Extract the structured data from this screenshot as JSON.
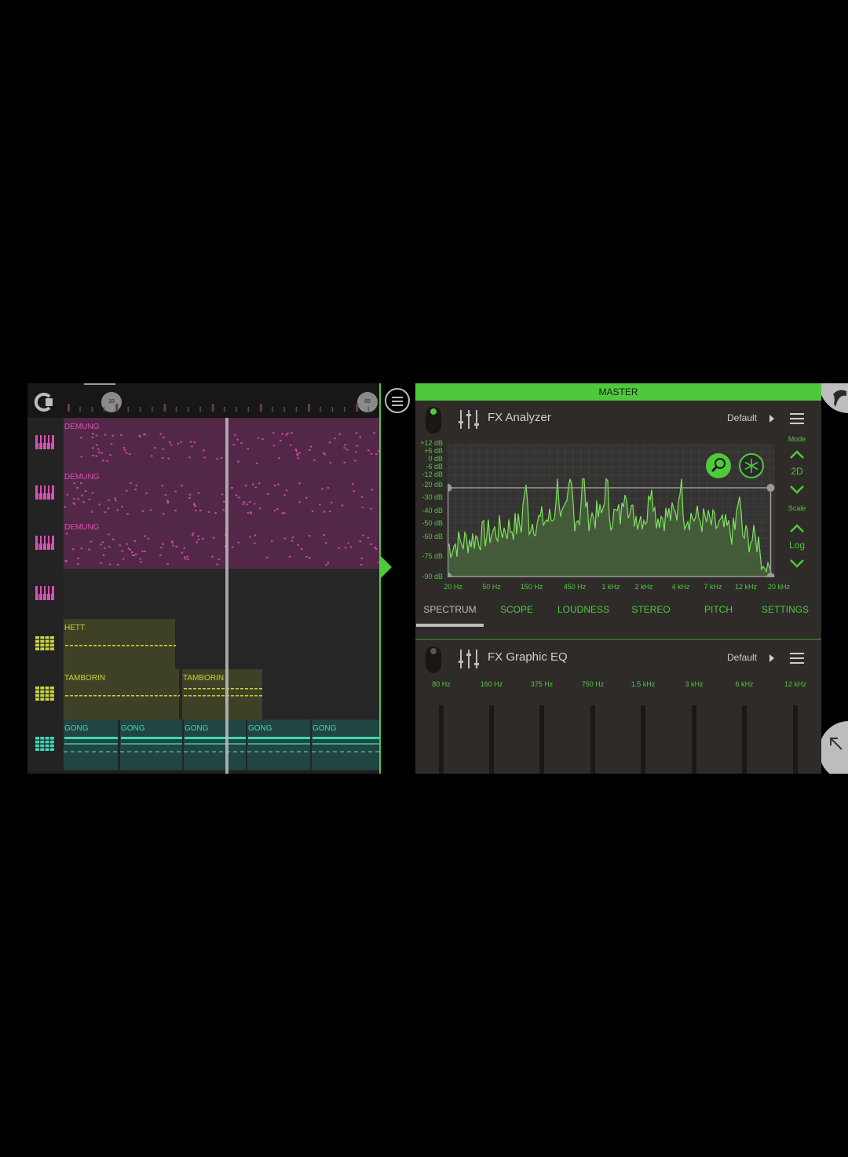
{
  "arranger": {
    "markers": [
      "33",
      "65"
    ],
    "tracks": [
      {
        "icon": "piano-icon",
        "color": "#d94fb5",
        "clips": [
          {
            "label": "DEMUNG",
            "type": "melody"
          }
        ]
      },
      {
        "icon": "piano-icon",
        "color": "#d94fb5",
        "clips": [
          {
            "label": "DEMUNG",
            "type": "melody"
          }
        ]
      },
      {
        "icon": "piano-icon",
        "color": "#d94fb5",
        "clips": [
          {
            "label": "DEMUNG",
            "type": "melody"
          }
        ]
      },
      {
        "icon": "piano-icon",
        "color": "#d94fb5",
        "clips": []
      },
      {
        "icon": "drum-pads-icon",
        "color": "#c9d23a",
        "clips": [
          {
            "label": "HETT",
            "type": "pattern"
          }
        ]
      },
      {
        "icon": "drum-pads-icon",
        "color": "#c9d23a",
        "clips": [
          {
            "label": "TAMBORIN",
            "type": "pattern"
          },
          {
            "label": "TAMBORIN",
            "type": "pattern"
          }
        ]
      },
      {
        "icon": "drum-pads-icon",
        "color": "#3fd6b4",
        "clips": [
          {
            "label": "GONG",
            "type": "pattern"
          },
          {
            "label": "GONG",
            "type": "pattern"
          },
          {
            "label": "GONG",
            "type": "pattern"
          },
          {
            "label": "GONG",
            "type": "pattern"
          },
          {
            "label": "GONG",
            "type": "pattern"
          }
        ]
      }
    ]
  },
  "master": {
    "title": "MASTER",
    "analyzer": {
      "name": "FX Analyzer",
      "preset": "Default",
      "power_on": true,
      "db_labels": [
        "+12 dB",
        "+6 dB",
        "0 dB",
        "-6 dB",
        "-12 dB",
        "-20 dB",
        "-30 dB",
        "-40 dB",
        "-50 dB",
        "-60 dB",
        "-75 dB",
        "-90 dB"
      ],
      "hz_labels": [
        "20 Hz",
        "50 Hz",
        "150 Hz",
        "450 Hz",
        "1 kHz",
        "2 kHz",
        "4 kHz",
        "7 kHz",
        "12 kHz",
        "20 kHz"
      ],
      "mode_label": "Mode",
      "mode_value": "2D",
      "scale_label": "Scale",
      "scale_value": "Log",
      "zoom_icon": "magnifier-icon",
      "freeze_icon": "snowflake-icon"
    },
    "tabs": [
      {
        "label": "SPECTRUM",
        "active": true
      },
      {
        "label": "SCOPE",
        "active": false
      },
      {
        "label": "LOUDNESS",
        "active": false
      },
      {
        "label": "STEREO",
        "active": false
      },
      {
        "label": "PITCH",
        "active": false
      },
      {
        "label": "SETTINGS",
        "active": false
      }
    ],
    "graphic_eq": {
      "name": "FX Graphic EQ",
      "preset": "Default",
      "power_on": false,
      "bands": [
        "80 Hz",
        "160 Hz",
        "375 Hz",
        "750 Hz",
        "1.5 kHz",
        "3 kHz",
        "6 kHz",
        "12 kHz"
      ]
    }
  },
  "colors": {
    "accent": "#4fc93c",
    "melody": "#d94fb5",
    "pattern_yellow": "#c9d23a",
    "pattern_teal": "#3fd6b4"
  }
}
